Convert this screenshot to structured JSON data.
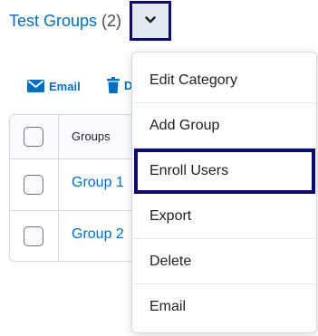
{
  "header": {
    "title": "Test Groups",
    "count": "(2)"
  },
  "toolbar": {
    "email_label": "Email",
    "delete_label": "D"
  },
  "table": {
    "column_header": "Groups",
    "rows": [
      {
        "name": "Group 1"
      },
      {
        "name": "Group 2"
      }
    ]
  },
  "menu": {
    "items": [
      {
        "label": "Edit Category"
      },
      {
        "label": "Add Group"
      },
      {
        "label": "Enroll Users",
        "highlighted": true
      },
      {
        "label": "Export"
      },
      {
        "label": "Delete"
      },
      {
        "label": "Email"
      }
    ]
  },
  "colors": {
    "link": "#006fbf",
    "highlight_border": "#0c0a6e",
    "toggle_bg": "#e3e9f1"
  },
  "icons": {
    "toggle": "chevron-down-icon",
    "email": "envelope-icon",
    "delete": "trash-icon"
  }
}
